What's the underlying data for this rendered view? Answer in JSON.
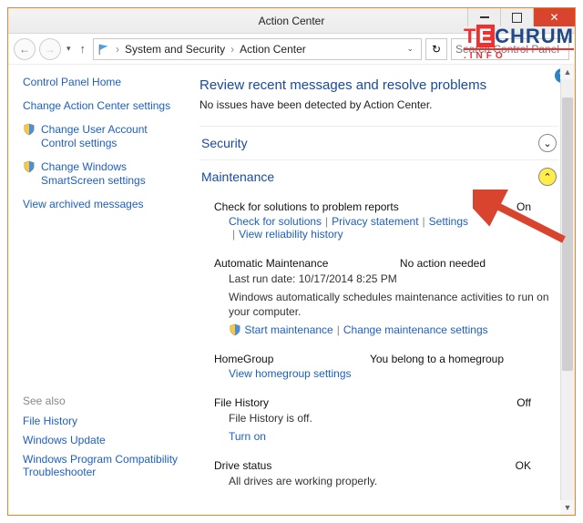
{
  "window": {
    "title": "Action Center"
  },
  "breadcrumb": {
    "item1": "System and Security",
    "item2": "Action Center"
  },
  "search": {
    "placeholder": "Search Control Panel"
  },
  "sidebar": {
    "home": "Control Panel Home",
    "items": [
      "Change Action Center settings",
      "Change User Account Control settings",
      "Change Windows SmartScreen settings",
      "View archived messages"
    ],
    "seealso_hd": "See also",
    "seealso": [
      "File History",
      "Windows Update",
      "Windows Program Compatibility Troubleshooter"
    ]
  },
  "main": {
    "heading": "Review recent messages and resolve problems",
    "subtext": "No issues have been detected by Action Center.",
    "security_title": "Security",
    "maint_title": "Maintenance",
    "problem_reports": {
      "title": "Check for solutions to problem reports",
      "status": "On",
      "links": {
        "check": "Check for solutions",
        "privacy": "Privacy statement",
        "settings": "Settings",
        "reliability": "View reliability history"
      }
    },
    "automaint": {
      "title": "Automatic Maintenance",
      "status": "No action needed",
      "last_run": "Last run date: 10/17/2014 8:25 PM",
      "desc": "Windows automatically schedules maintenance activities to run on your computer.",
      "links": {
        "start": "Start maintenance",
        "change": "Change maintenance settings"
      }
    },
    "homegroup": {
      "title": "HomeGroup",
      "status": "You belong to a homegroup",
      "link": "View homegroup settings"
    },
    "filehistory": {
      "title": "File History",
      "status": "Off",
      "desc": "File History is off.",
      "link": "Turn on"
    },
    "drive": {
      "title": "Drive status",
      "status": "OK",
      "desc": "All drives are working properly."
    }
  },
  "watermark": {
    "t": "T",
    "e": "E",
    "rest": "CHRUM",
    "info": ".INFO"
  }
}
